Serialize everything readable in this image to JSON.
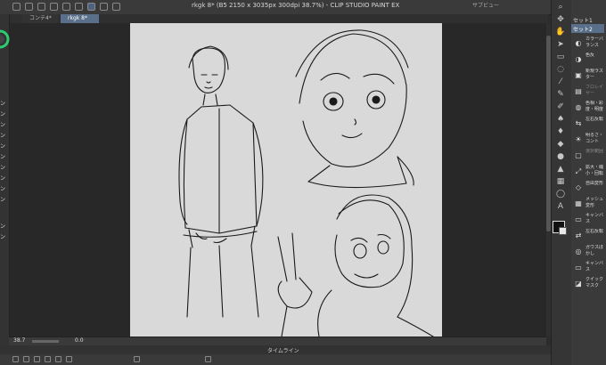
{
  "window": {
    "title": "rkgk 8* (B5 2150 x 3035px 300dpi 38.7%)  - CLIP STUDIO PAINT EX",
    "right_label": "サブビュー"
  },
  "tabs": [
    {
      "label": "コンテ4*"
    },
    {
      "label": "rkgk 8*"
    }
  ],
  "status": {
    "zoom": "38.7",
    "rotation": "0.0"
  },
  "timeline": {
    "label": "タイムライン"
  },
  "subtool_panel": {
    "header": "セット1",
    "selected_set": "セット2",
    "items": [
      {
        "label": "カラーバランス",
        "icon": "color-balance-icon"
      },
      {
        "label": "色反",
        "icon": "invert-icon"
      },
      {
        "label": "新規ラスター",
        "icon": "new-raster-icon"
      },
      {
        "label": "ブロレイヤー",
        "icon": "layer-icon",
        "dim": true
      },
      {
        "label": "色相・彩度・明度",
        "icon": "hue-icon"
      },
      {
        "label": "左右反転",
        "icon": "flip-icon"
      },
      {
        "label": "明るさ・コント",
        "icon": "brightness-icon"
      },
      {
        "label": "選択範囲",
        "icon": "selection-icon",
        "dim": true
      },
      {
        "label": "拡大・縮小・回転",
        "icon": "transform-icon"
      },
      {
        "label": "自由変形",
        "icon": "free-transform-icon"
      },
      {
        "label": "メッシュ変形",
        "icon": "mesh-icon"
      },
      {
        "label": "キャンバス",
        "icon": "canvas-icon"
      },
      {
        "label": "左右反転",
        "icon": "flip2-icon"
      },
      {
        "label": "ガウスぼかし",
        "icon": "blur-icon"
      },
      {
        "label": "キャンバス",
        "icon": "canvas2-icon"
      },
      {
        "label": "クイックマスク",
        "icon": "quickmask-icon"
      }
    ]
  },
  "left_panel": {
    "labels": [
      "ン",
      "ン",
      "ン",
      "ン",
      "ン",
      "ン",
      "ン",
      "ン",
      "ン",
      "ン",
      "ン",
      "ン"
    ]
  },
  "colors": {
    "main": "#111111",
    "sub": "#e8e8e8",
    "accent": "#5a6f8a"
  }
}
